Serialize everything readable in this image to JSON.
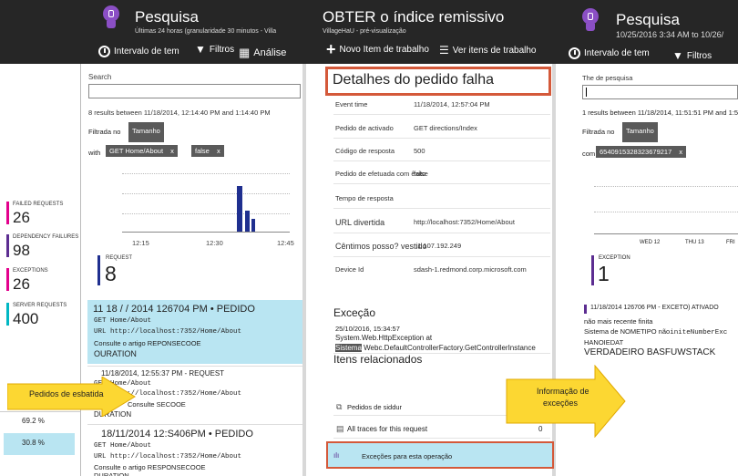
{
  "left_blade": {
    "title": "Pesquisa",
    "subtitle": "Últimas 24 horas (granularidade 30 minutos - Villa",
    "cmd_time": "Intervalo de tem",
    "cmd_filters": "Filtros",
    "cmd_analysis": "Análise",
    "search_label": "Search",
    "search_value": "",
    "results_text": "8 results between 11/18/2014, 12:14:40 PM and 1:14:40 PM",
    "filtered_label": "Filtrada no",
    "filtered_overlap": "Tamanho",
    "with_label": "with",
    "filter_tag_1": "GET Home/About",
    "filter_tag_2": "false",
    "tag_close": "x",
    "chart_ticks": [
      "12:15",
      "12:30",
      "12:45"
    ],
    "request_label": "REQUEST",
    "request_count": "8",
    "metrics": [
      {
        "label": "FAILED REQUESTS",
        "value": "26",
        "color": "#e3008c"
      },
      {
        "label": "DEPENDENCY FAILURES",
        "value": "98",
        "color": "#5c2d91"
      },
      {
        "label": "EXCEPTIONS",
        "value": "26",
        "color": "#e3008c"
      },
      {
        "label": "SERVER REQUESTS",
        "value": "400",
        "color": "#00b7c3"
      }
    ],
    "pct_1": "69.2 %",
    "pct_2": "30.8 %",
    "results": [
      {
        "title": "11 18 / / 2014 126704 PM • PEDIDO",
        "line1": "GET Home/About",
        "line2": "URL http://localhost:7352/Home/About",
        "line3": "Consulte o artigo REPONSECOOE",
        "line4": "OURATION"
      },
      {
        "title": "11/18/2014, 12:55:37 PM - REQUEST",
        "line1": "GET Home/About",
        "line2": "URL http://localhost:7352/Home/About",
        "line3": "Consulte SECOOE",
        "line4": "DURATION"
      },
      {
        "title": "18/11/2014 12:S406PM • PEDIDO",
        "line1": "GET Home/About",
        "line2": "URL http://localhost:7352/Home/About",
        "line3": "Consulte o artigo RESPONSECOOE",
        "line4": "DURATION"
      }
    ]
  },
  "callout_left": "Pedidos de esbatida",
  "middle_blade": {
    "title": "OBTER o índice remissivo",
    "subtitle": "VillageHaU - pré-visualização",
    "cmd_new": "Novo Item de trabalho",
    "cmd_view": "Ver itens de trabalho",
    "details_heading": "Detalhes do pedido falha",
    "rows": [
      {
        "label": "Event time",
        "value": "11/18/2014, 12:57:04 PM"
      },
      {
        "label": "Pedido de activado",
        "value": "GET directions/Index"
      },
      {
        "label": "Código de resposta",
        "value": "500"
      },
      {
        "label": "Pedido de efetuada com êxito",
        "value": "false"
      },
      {
        "label": "Tempo de resposta",
        "value": ""
      },
      {
        "label": "URL divertida",
        "value": "http://localhost:7352/Home/About"
      },
      {
        "label": "Cêntimos posso? vestido",
        "value": "::1 107.192.249"
      },
      {
        "label": "Device Id",
        "value": "sdash-1.redmond.corp.microsoft.com"
      }
    ],
    "exception_heading": "Exceção",
    "exception_time": "25/10/2016, 15:34:57",
    "exception_line1": "System.Web.HttpException at",
    "exception_line2_a": "Sistema",
    "exception_line2_b": "W",
    "exception_line2_c": "ebc.DefaultControllerFactory.GetControllerInstance",
    "related_heading": "Itens relacionados",
    "related": [
      {
        "label": "Pedidos de siddur",
        "count": ""
      },
      {
        "label": "All traces for this request",
        "count": "0"
      },
      {
        "label": "Exceções para esta operação",
        "count": ""
      }
    ]
  },
  "callout_right_1": "Informação de",
  "callout_right_2": "exceções",
  "right_blade": {
    "title": "Pesquisa",
    "subtitle": "10/25/2016 3:34 AM to 10/26/",
    "cmd_time": "Intervalo de tem",
    "cmd_filters": "Filtros",
    "search_label": "The de pesquisa",
    "results_text": "1 results between 11/18/2014, 11:51:51 PM and 1:51",
    "filtered_label": "Filtrada no",
    "filtered_overlap": "Tamanho",
    "with_label": "com",
    "filter_tag": "6540915328323679217",
    "tag_close": "x",
    "ticks": [
      "WED 12",
      "THU 13",
      "FRI"
    ],
    "exception_label": "EXCEPTION",
    "exception_count": "1",
    "item_title": "11/18/2014 126706 PM - EXCETO) ATIVADO",
    "item_line1": "não mais recente finita",
    "item_line2_a": "Sistema de NOMETIPO não",
    "item_line2_b": "initeNumberExc",
    "item_line3": "HANOIEDAT",
    "item_line4": "VERDADEIRO BASFUWSTACK"
  }
}
